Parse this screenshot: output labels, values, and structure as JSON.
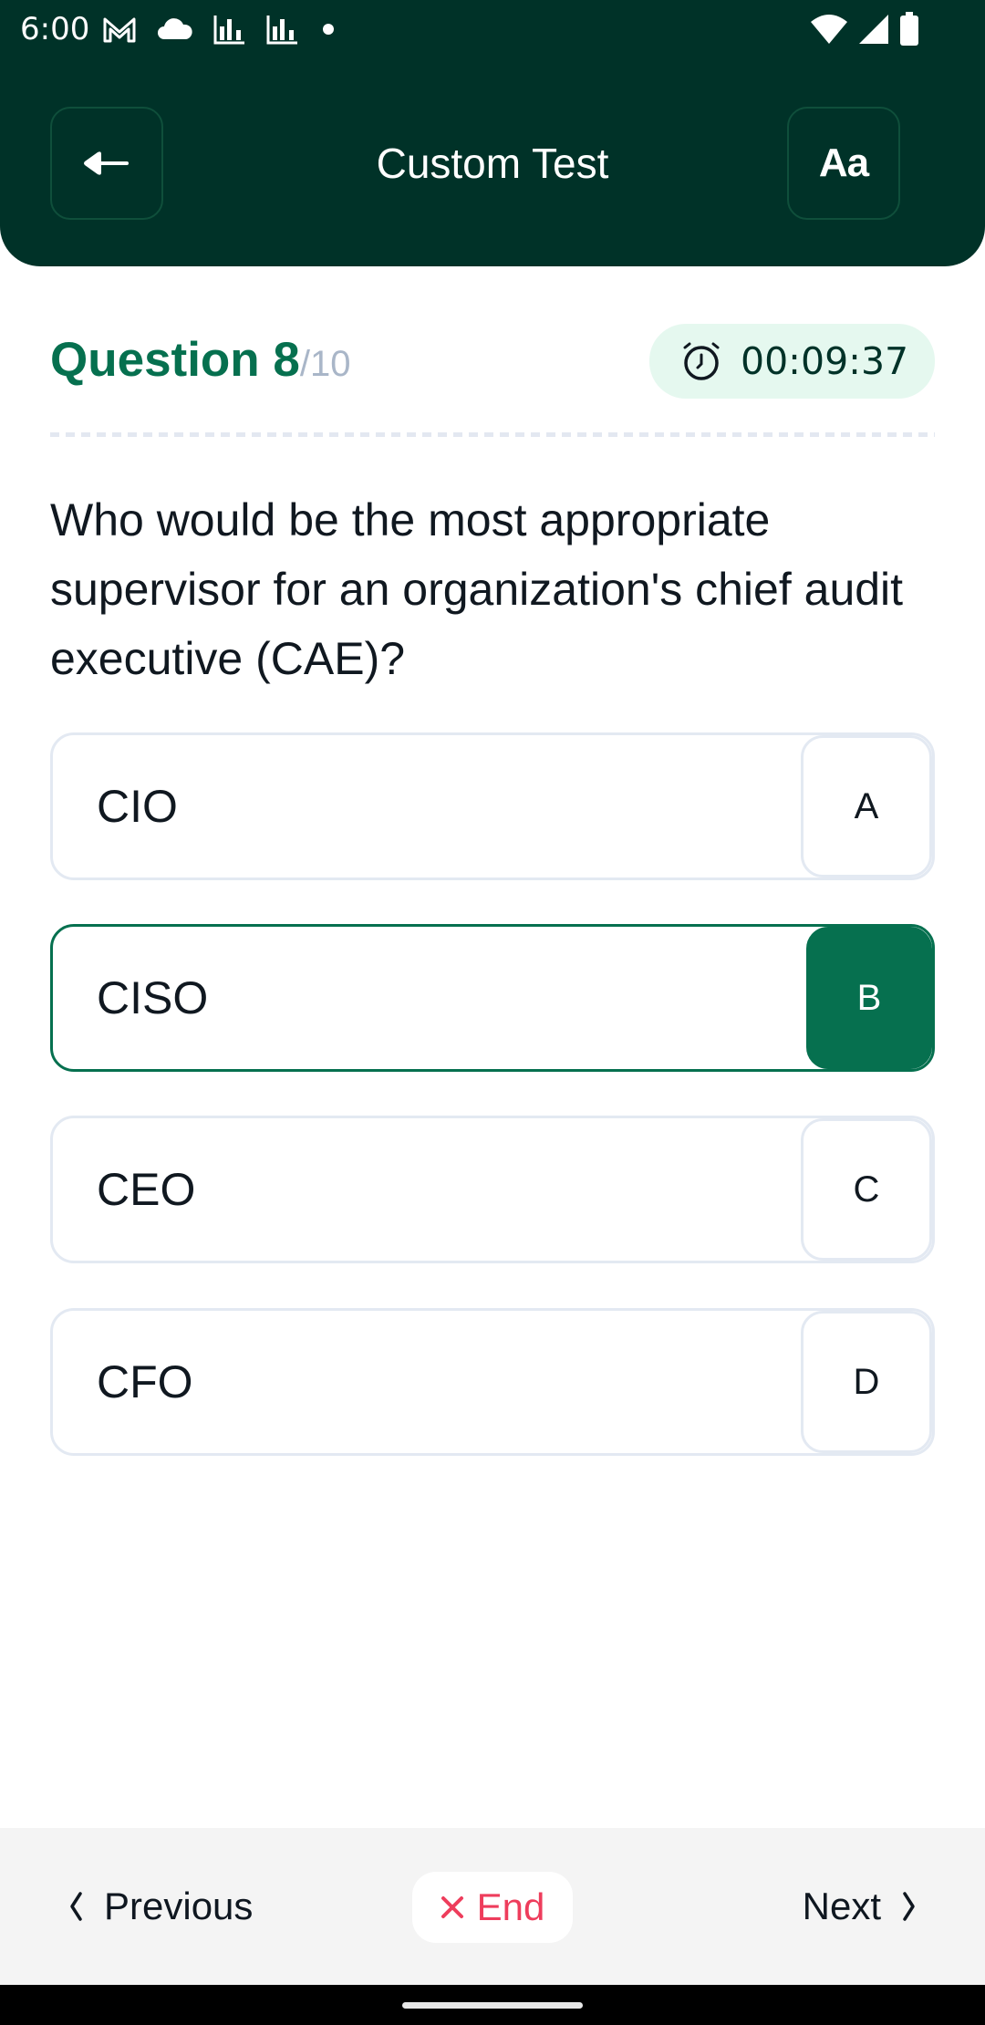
{
  "status_bar": {
    "time": "6:00",
    "left_icons": [
      "gmail-icon",
      "cloud-icon",
      "stats-icon",
      "stats-icon",
      "dot-icon"
    ],
    "right_icons": [
      "wifi-icon",
      "signal-icon",
      "battery-icon"
    ]
  },
  "header": {
    "title": "Custom Test",
    "back_icon": "back-arrow-icon",
    "font_button_label": "Aa"
  },
  "question": {
    "label": "Question 8",
    "total": "/10",
    "timer": "00:09:37",
    "text": "Who would be the most appropriate supervisor for an organization's chief audit executive (CAE)?"
  },
  "options": [
    {
      "text": "CIO",
      "letter": "A",
      "selected": false
    },
    {
      "text": "CISO",
      "letter": "B",
      "selected": true
    },
    {
      "text": "CEO",
      "letter": "C",
      "selected": false
    },
    {
      "text": "CFO",
      "letter": "D",
      "selected": false
    }
  ],
  "footer": {
    "previous_label": "Previous",
    "end_label": "End",
    "next_label": "Next"
  },
  "colors": {
    "header_bg": "#003228",
    "accent": "#06704f",
    "timer_bg": "#e5f8ef",
    "end_red": "#ee3d5c"
  }
}
